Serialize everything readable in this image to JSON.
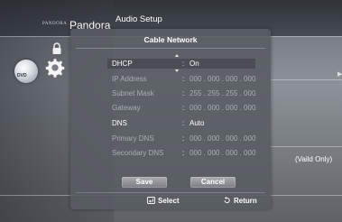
{
  "header": {
    "pandora_logo": "PANDORA",
    "pandora_label": "Pandora",
    "audio_setup": "Audio Setup"
  },
  "dialog": {
    "title": "Cable Network",
    "rows": [
      {
        "label": "DHCP",
        "value": "On"
      },
      {
        "label": "IP Address",
        "value": "000 . 000 . 000 . 000"
      },
      {
        "label": "Subnet Mask",
        "value": "255 . 255 . 255 . 000"
      },
      {
        "label": "Gateway",
        "value": "000 . 000 . 000 . 000"
      },
      {
        "label": "DNS",
        "value": "Auto"
      },
      {
        "label": "Primary DNS",
        "value": "000 . 000 . 000 . 000"
      },
      {
        "label": "Secondary DNS",
        "value": "000 . 000 . 000 . 000"
      }
    ],
    "colon": ":",
    "save_label": "Save",
    "cancel_label": "Cancel"
  },
  "footer": {
    "select_label": "Select",
    "return_label": "Return"
  },
  "background": {
    "vaild_only": "(Vaild Only)",
    "right_arrow": "▶"
  },
  "icons": {
    "lock": "lock-icon",
    "gear": "gear-icon",
    "disc": "dvd-disc-icon",
    "disc_label": "DVD"
  }
}
